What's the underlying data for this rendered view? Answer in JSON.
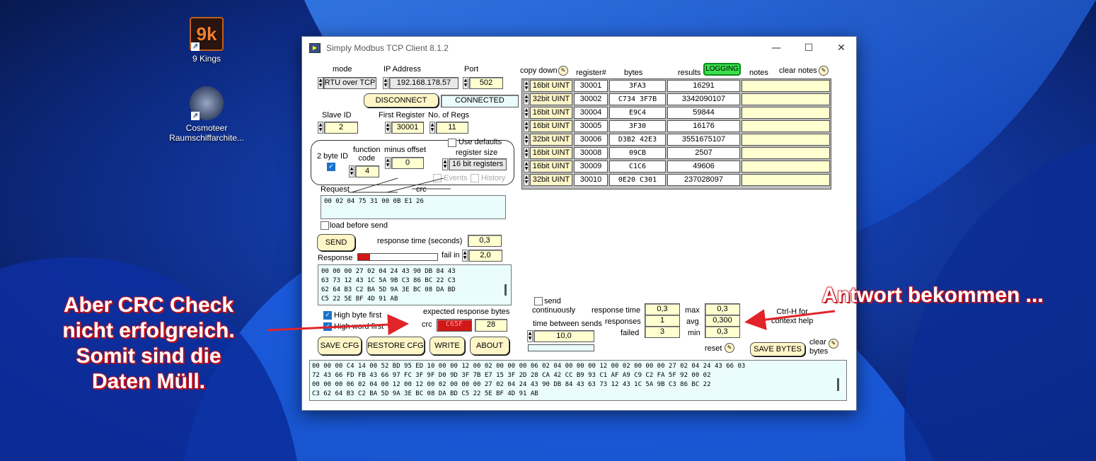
{
  "desktop": {
    "icons": [
      {
        "label": "9 Kings",
        "icon": "9-kings-game-icon"
      },
      {
        "label": "Cosmoteer\nRaumschiffarchite...",
        "icon": "cosmoteer-game-icon"
      }
    ]
  },
  "window": {
    "title": "Simply Modbus TCP Client 8.1.2",
    "controls": [
      "minimize",
      "maximize",
      "close"
    ]
  },
  "connection": {
    "mode_label": "mode",
    "mode_value": "RTU over TCP",
    "ip_label": "IP Address",
    "ip_value": "192.168.178.57",
    "port_label": "Port",
    "port_value": "502",
    "disconnect_label": "DISCONNECT",
    "status_value": "CONNECTED"
  },
  "request": {
    "slave_label": "Slave ID",
    "slave_value": "2",
    "first_reg_label": "First Register",
    "first_reg_value": "30001",
    "num_regs_label": "No. of Regs",
    "num_regs_value": "11",
    "two_byte_label": "2 byte ID",
    "function_label": "function\ncode",
    "function_value": "4",
    "minus_offset_label": "minus offset",
    "minus_offset_value": "0",
    "use_defaults_label": "Use defaults",
    "register_size_label": "register size",
    "register_size_value": "16 bit registers",
    "events_label": "Events",
    "history_label": "History",
    "request_label": "Request",
    "crc_label": "crc",
    "request_bytes": "00 02 04 75 31 00 0B E1 26",
    "load_before_send_label": "load before send"
  },
  "send": {
    "send_label": "SEND",
    "response_time_label": "response time (seconds)",
    "response_time_value": "0,3",
    "response_label": "Response",
    "fail_in_label": "fail in",
    "fail_in_value": "2,0",
    "progress": 0.15,
    "response_bytes": "00 00 00 27 02 04 24 43 90 DB 84 43\n63 73 12 43 1C 5A 9B C3 86 BC 22 C3\n62 64 B3 C2 BA 5D 9A 3E BC 08 DA BD\nC5 22 5E BF 4D 91 AB"
  },
  "options": {
    "high_byte_label": "High byte first",
    "high_word_label": "High word first",
    "expected_label": "expected response bytes",
    "crc_label": "crc",
    "crc_value": "C65F",
    "expected_value": "28"
  },
  "buttons": {
    "save_cfg": "SAVE CFG",
    "restore_cfg": "RESTORE CFG",
    "write": "WRITE",
    "about": "ABOUT",
    "save_bytes": "SAVE BYTES"
  },
  "table": {
    "copy_down_label": "copy down",
    "headers": {
      "register": "register#",
      "bytes": "bytes",
      "results": "results",
      "notes": "notes"
    },
    "logging_label": "LOGGING",
    "clear_notes_label": "clear notes",
    "rows": [
      {
        "type": "16bit UINT",
        "register": "30001",
        "bytes": "3FA3",
        "result": "16291"
      },
      {
        "type": "32bit UINT",
        "register": "30002",
        "bytes": "C734 3F7B",
        "result": "3342090107"
      },
      {
        "type": "16bit UINT",
        "register": "30004",
        "bytes": "E9C4",
        "result": "59844"
      },
      {
        "type": "16bit UINT",
        "register": "30005",
        "bytes": "3F30",
        "result": "16176"
      },
      {
        "type": "32bit UINT",
        "register": "30006",
        "bytes": "D3B2 42E3",
        "result": "3551675107"
      },
      {
        "type": "16bit UINT",
        "register": "30008",
        "bytes": "09CB",
        "result": "2507"
      },
      {
        "type": "16bit UINT",
        "register": "30009",
        "bytes": "C1C6",
        "result": "49606"
      },
      {
        "type": "32bit UINT",
        "register": "30010",
        "bytes": "0E20 C301",
        "result": "237028097"
      }
    ]
  },
  "stats": {
    "send_cont_label": "send\ncontinuously",
    "between_label": "time between sends",
    "between_value": "10,0",
    "response_time_label": "response time",
    "response_time_value": "0,3",
    "responses_label": "responses",
    "responses_value": "1",
    "failed_label": "failed",
    "failed_value": "3",
    "max_label": "max",
    "max_value": "0,3",
    "avg_label": "avg",
    "avg_value": "0,300",
    "min_label": "min",
    "min_value": "0,3",
    "reset_label": "reset",
    "help_label": "Ctrl-H for\ncontext help",
    "clear_bytes_label": "clear\nbytes"
  },
  "log": {
    "text": "00 00 00 C4 14 00 52 BD 95 ED 10 00 00 12 00 02 00 00 00 06 02 04 00 00 00 12 00 02 00 00 00 27 02 04 24 43 66 03\n72 43 66 FD FB 43 66 97 FC 3F 9F D0 9D 3F 7B E7 15 3F 2D 28 CA 42 CC B9 93 C1 AF A9 C9 C2 FA 5F 92 00 02\n00 00 00 06 02 04 00 12 00 12 00 02 00 00 00 27 02 04 24 43 90 DB 84 43 63 73 12 43 1C 5A 9B C3 86 BC 22\nC3 62 64 B3 C2 BA 5D 9A 3E BC 08 DA BD C5 22 5E BF 4D 91 AB"
  },
  "annotations": {
    "left": "Aber CRC Check\nnicht erfolgreich.\nSomit sind die\nDaten Müll.",
    "right": "Antwort bekommen ...",
    "color": "#e0242a"
  }
}
